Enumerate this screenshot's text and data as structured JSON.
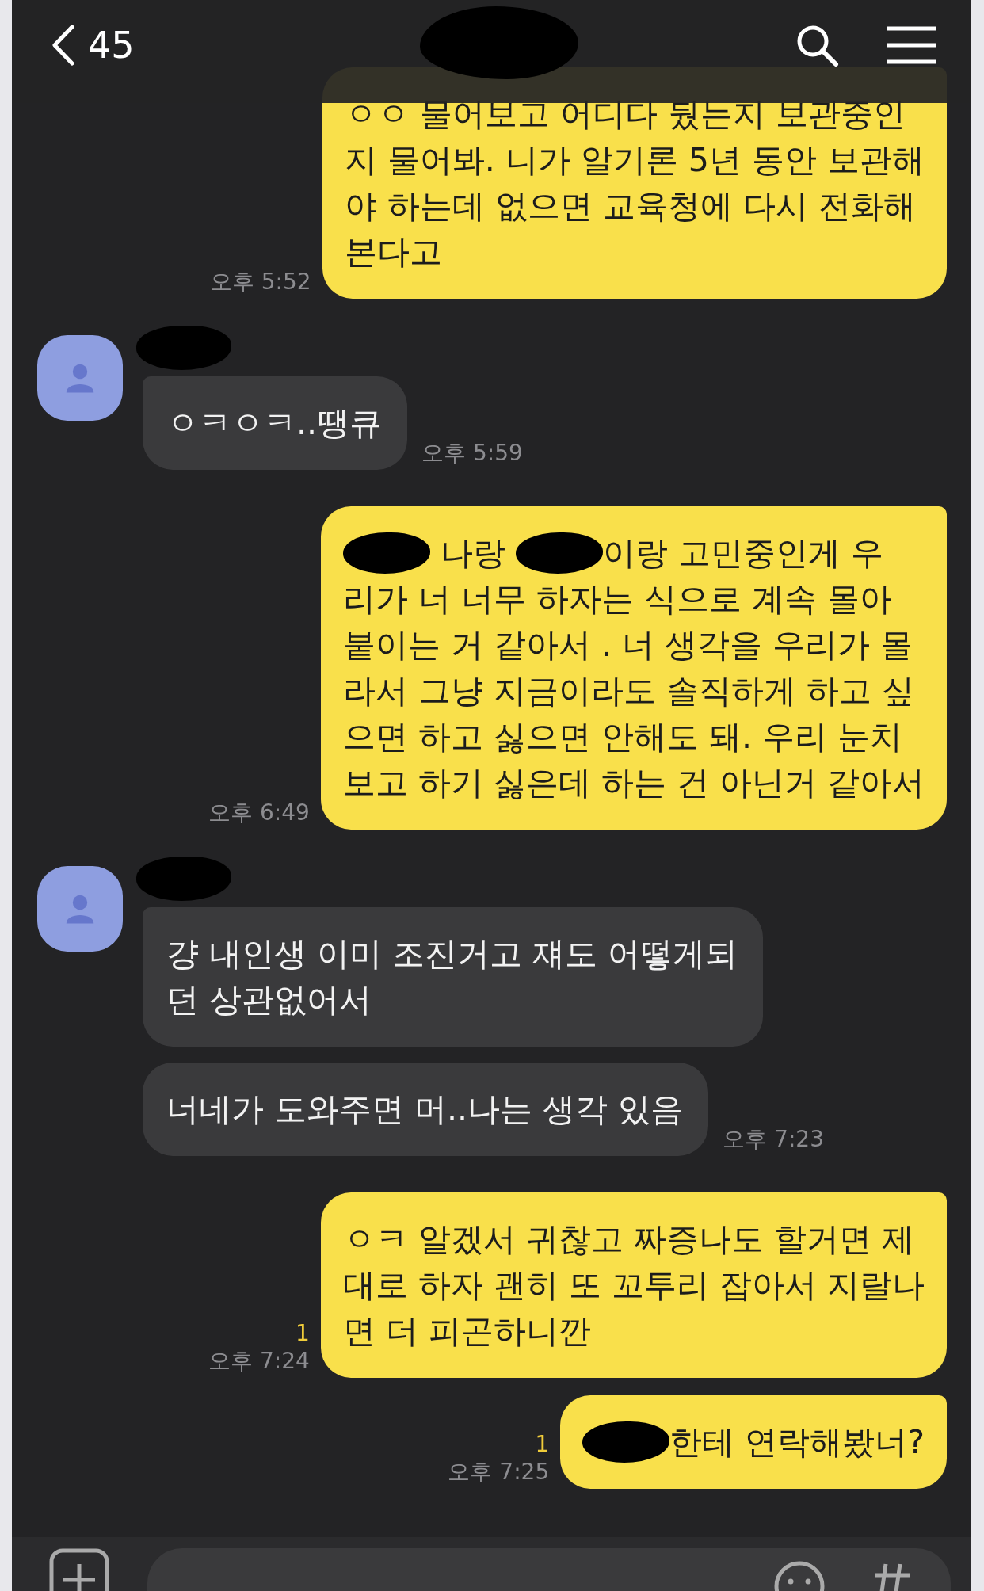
{
  "header": {
    "back_count": "45"
  },
  "messages": [
    {
      "kind": "sent",
      "time": "오후 5:52",
      "bubbles": [
        {
          "lines": [
            [
              "ㅇㅇ 물어보고 어디다 뒀는지 보관중인"
            ],
            [
              "지 물어봐. 니가 알기론 5년 동안 보관해"
            ],
            [
              "야 하는데 없으면 교육청에 다시 전화해"
            ],
            [
              "본다고"
            ]
          ]
        }
      ]
    },
    {
      "kind": "received",
      "time": "오후 5:59",
      "bubbles": [
        {
          "lines": [
            [
              "ㅇㅋㅇㅋ..땡큐"
            ]
          ]
        }
      ]
    },
    {
      "kind": "sent",
      "time": "오후 6:49",
      "bubbles": [
        {
          "lines": [
            [
              {
                "kind": "redaction"
              },
              " 나랑 ",
              {
                "kind": "redaction"
              },
              "이랑 고민중인게 우"
            ],
            [
              "리가 너 너무 하자는 식으로 계속 몰아"
            ],
            [
              "붙이는 거 같아서 . 너 생각을 우리가 몰"
            ],
            [
              "라서 그냥 지금이라도 솔직하게 하고 싶"
            ],
            [
              "으면 하고 싫으면 안해도 돼. 우리 눈치"
            ],
            [
              "보고 하기 싫은데 하는 건 아닌거 같아서"
            ]
          ]
        }
      ]
    },
    {
      "kind": "received",
      "time": "오후 7:23",
      "bubbles": [
        {
          "lines": [
            [
              "걍 내인생 이미 조진거고 쟤도 어떻게되"
            ],
            [
              "던 상관없어서"
            ]
          ]
        },
        {
          "lines": [
            [
              "너네가 도와주면 머..나는 생각 있음"
            ]
          ]
        }
      ]
    },
    {
      "kind": "sent",
      "time": "오후 7:24",
      "unread": "1",
      "bubbles": [
        {
          "lines": [
            [
              "ㅇㅋ 알겠서 귀찮고 짜증나도 할거면 제"
            ],
            [
              "대로 하자 괜히 또 꼬투리 잡아서 지랄나"
            ],
            [
              "면 더 피곤하니깐"
            ]
          ]
        }
      ]
    },
    {
      "kind": "sent",
      "time": "오후 7:25",
      "unread": "1",
      "bubbles": [
        {
          "lines": [
            [
              {
                "kind": "redaction"
              },
              "한테 연락해봤너?"
            ]
          ]
        }
      ]
    }
  ]
}
